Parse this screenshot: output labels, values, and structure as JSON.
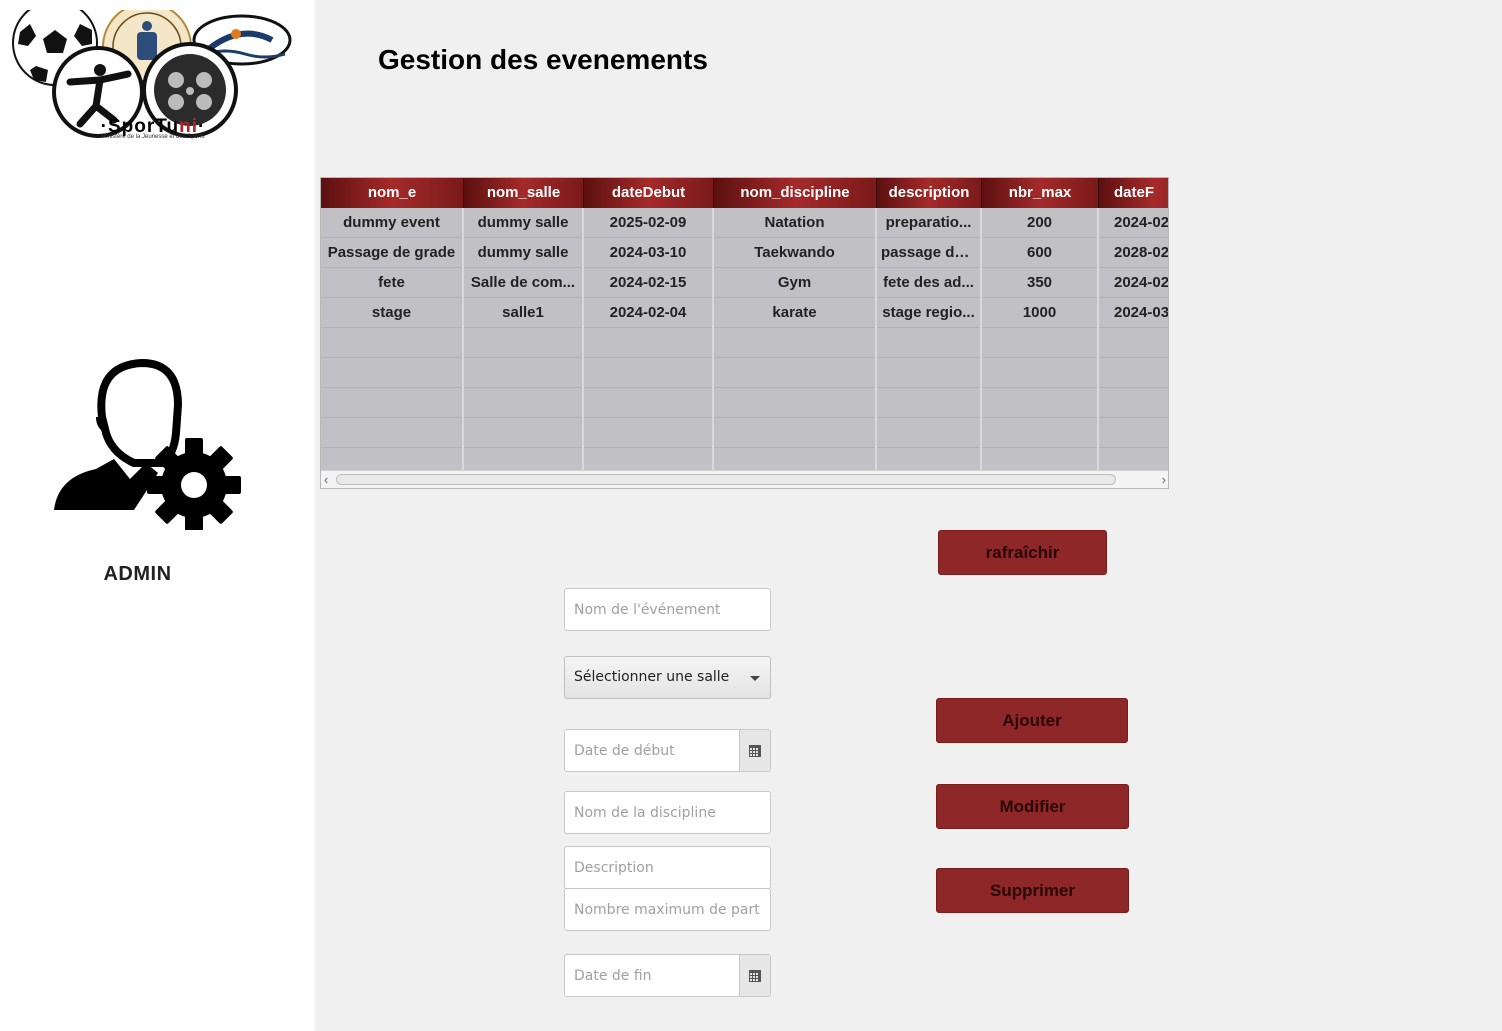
{
  "app": {
    "logo": {
      "name_part1": "SporTu",
      "name_part2": "ni",
      "tagline": "Ministère de la Jeunesse et des Sports"
    },
    "title": "Gestion des evenements",
    "user": {
      "role": "ADMIN",
      "icon": "admin-user-gear-icon"
    }
  },
  "table": {
    "columns": [
      "nom_e",
      "nom_salle",
      "dateDebut",
      "nom_discipline",
      "description",
      "nbr_max",
      "dateF"
    ],
    "rows": [
      [
        "dummy event",
        "dummy salle",
        "2025-02-09",
        "Natation",
        "preparatio...",
        "200",
        "2024-02"
      ],
      [
        "Passage de grade",
        "dummy salle",
        "2024-03-10",
        "Taekwando",
        "passage de ...",
        "600",
        "2028-02"
      ],
      [
        "fete",
        "Salle de com...",
        "2024-02-15",
        "Gym",
        "fete des ad...",
        "350",
        "2024-02"
      ],
      [
        "stage",
        "salle1",
        "2024-02-04",
        "karate",
        "stage regio...",
        "1000",
        "2024-03"
      ]
    ],
    "empty_rows": 5
  },
  "buttons": {
    "refresh": "rafraîchir",
    "add": "Ajouter",
    "edit": "Modifier",
    "delete": "Supprimer"
  },
  "form": {
    "event_name_placeholder": "Nom de l'événement",
    "salle_select": "Sélectionner une salle",
    "date_start_placeholder": "Date de début",
    "discipline_placeholder": "Nom de la discipline",
    "description_placeholder": "Description",
    "max_participants_placeholder": "Nombre maximum de participants",
    "date_end_placeholder": "Date de fin"
  },
  "colors": {
    "accent": "#8e2727",
    "header_dark": "#5c1010",
    "table_bg": "#c1c0c4"
  }
}
